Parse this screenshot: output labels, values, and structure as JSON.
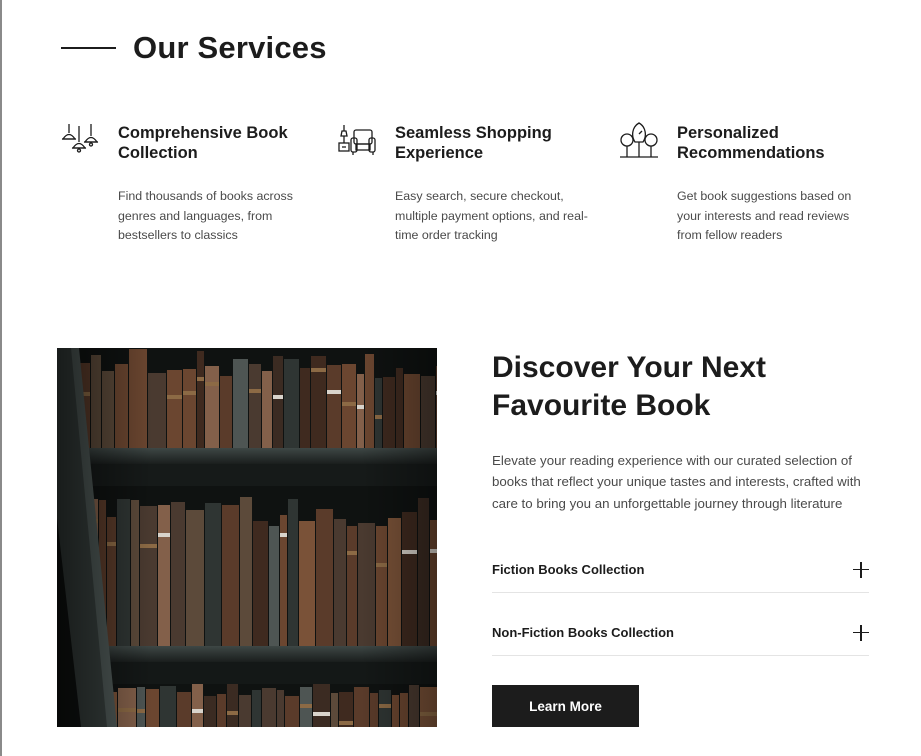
{
  "section": {
    "title": "Our Services"
  },
  "services": [
    {
      "icon": "hanging-lamps-icon",
      "title": "Comprehensive Book Collection",
      "description": "Find thousands of books across genres and languages, from bestsellers to classics"
    },
    {
      "icon": "armchair-reading-icon",
      "title": "Seamless Shopping Experience",
      "description": "Easy search, secure checkout, multiple payment options, and real-time order tracking"
    },
    {
      "icon": "trees-icon",
      "title": "Personalized Recommendations",
      "description": "Get book suggestions based on your interests and read reviews from fellow readers"
    }
  ],
  "discover": {
    "image": "bookshelf-photo",
    "title": "Discover Your Next Favourite Book",
    "body": "Elevate your reading experience with our curated selection of books that reflect your unique tastes and interests, crafted with care to bring you an unforgettable journey through literature",
    "accordion": [
      {
        "label": "Fiction Books Collection",
        "icon": "plus-icon"
      },
      {
        "label": "Non-Fiction Books Collection",
        "icon": "plus-icon"
      }
    ],
    "button_label": "Learn More"
  },
  "colors": {
    "text": "#1c1c1c",
    "muted": "#4a4a4a",
    "button_bg": "#1c1c1c",
    "button_text": "#ffffff",
    "divider": "#e4e4e4"
  }
}
